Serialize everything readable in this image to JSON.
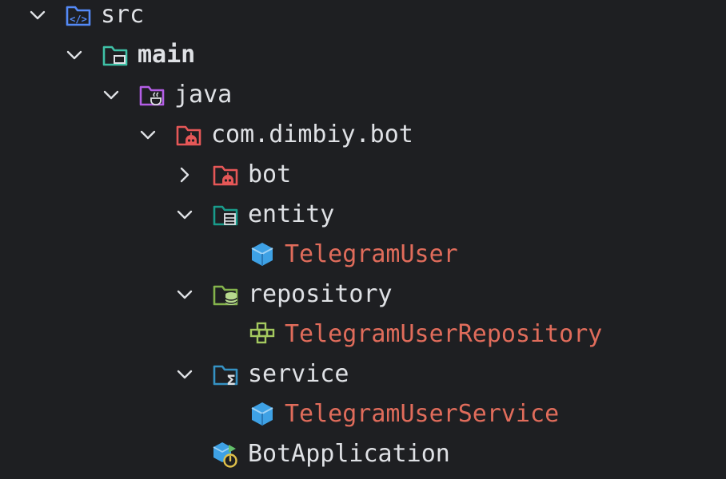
{
  "colors": {
    "background": "#1e1f22",
    "text": "#dfe1e5",
    "class_text": "#e06c5b",
    "src_folder": "#548af7",
    "main_folder": "#3fc1a7",
    "java_folder": "#b45ee6",
    "package_folder": "#e55757",
    "entity_folder": "#199b8b",
    "repository_folder": "#84b34c",
    "service_folder": "#3592c4",
    "class_icon": "#3ea1e5"
  },
  "tree": {
    "src": {
      "label": "src",
      "icon": "source-folder-icon",
      "expanded": true
    },
    "main": {
      "label": "main",
      "icon": "module-folder-icon",
      "expanded": true
    },
    "java": {
      "label": "java",
      "icon": "java-source-folder-icon",
      "expanded": true
    },
    "package": {
      "label": "com.dimbiy.bot",
      "icon": "bot-package-icon",
      "expanded": true
    },
    "bot": {
      "label": "bot",
      "icon": "bot-package-icon",
      "expanded": false
    },
    "entity": {
      "label": "entity",
      "icon": "entity-folder-icon",
      "expanded": true
    },
    "telegram_user": {
      "label": "TelegramUser",
      "icon": "entity-class-icon"
    },
    "repository": {
      "label": "repository",
      "icon": "repository-folder-icon",
      "expanded": true
    },
    "telegram_user_repository": {
      "label": "TelegramUserRepository",
      "icon": "repository-interface-icon"
    },
    "service": {
      "label": "service",
      "icon": "service-folder-icon",
      "expanded": true
    },
    "telegram_user_service": {
      "label": "TelegramUserService",
      "icon": "service-class-icon"
    },
    "bot_application": {
      "label": "BotApplication",
      "icon": "spring-boot-app-icon"
    }
  }
}
